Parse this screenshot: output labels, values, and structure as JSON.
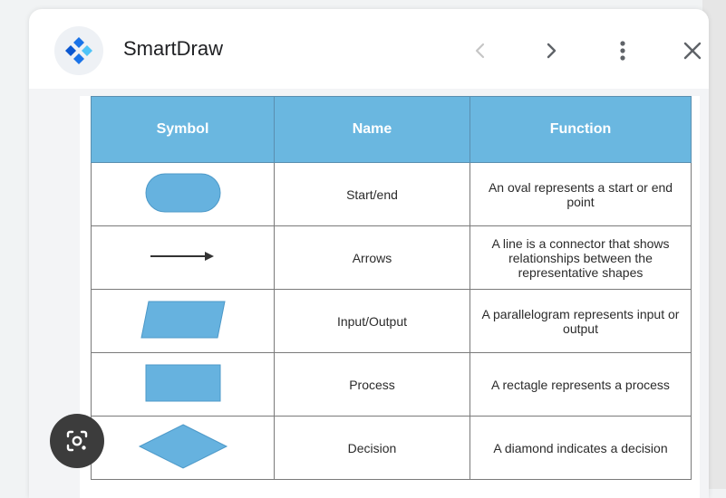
{
  "app": {
    "title": "SmartDraw",
    "logo_icon": "smartdraw-logo-icon",
    "buttons": {
      "prev_icon": "chevron-left-icon",
      "next_icon": "chevron-right-icon",
      "more_icon": "more-vert-icon",
      "close_icon": "close-icon"
    }
  },
  "table": {
    "headers": [
      "Symbol",
      "Name",
      "Function"
    ],
    "header_color": "#6ab7e0",
    "shape_color": "#66b2df",
    "rows": [
      {
        "symbol": "oval-shape",
        "name": "Start/end",
        "function": "An oval represents a start or end point"
      },
      {
        "symbol": "arrow-shape",
        "name": "Arrows",
        "function": "A line is a connector that shows relationships between the representative shapes"
      },
      {
        "symbol": "parallelogram-shape",
        "name": "Input/Output",
        "function": "A parallelogram represents input or output"
      },
      {
        "symbol": "rectangle-shape",
        "name": "Process",
        "function": "A rectagle represents a process"
      },
      {
        "symbol": "diamond-shape",
        "name": "Decision",
        "function": "A diamond indicates a decision"
      }
    ]
  },
  "lens": {
    "icon": "google-lens-icon"
  }
}
